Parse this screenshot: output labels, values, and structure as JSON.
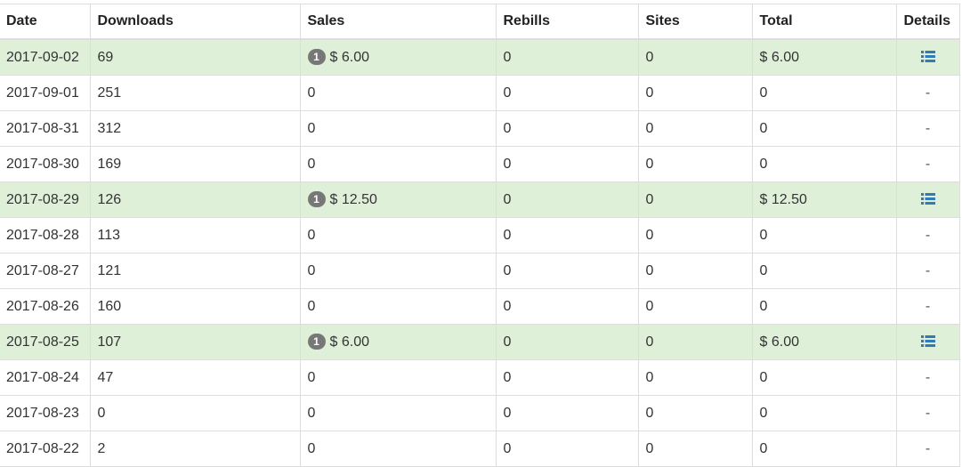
{
  "table": {
    "headers": {
      "date": "Date",
      "downloads": "Downloads",
      "sales": "Sales",
      "rebills": "Rebills",
      "sites": "Sites",
      "total": "Total",
      "details": "Details"
    },
    "rows": [
      {
        "date": "2017-09-02",
        "downloads": "69",
        "sales_count": "1",
        "sales": "$ 6.00",
        "rebills": "0",
        "sites": "0",
        "total": "$ 6.00",
        "details": "",
        "highlight": true
      },
      {
        "date": "2017-09-01",
        "downloads": "251",
        "sales_count": "",
        "sales": "0",
        "rebills": "0",
        "sites": "0",
        "total": "0",
        "details": "-",
        "highlight": false
      },
      {
        "date": "2017-08-31",
        "downloads": "312",
        "sales_count": "",
        "sales": "0",
        "rebills": "0",
        "sites": "0",
        "total": "0",
        "details": "-",
        "highlight": false
      },
      {
        "date": "2017-08-30",
        "downloads": "169",
        "sales_count": "",
        "sales": "0",
        "rebills": "0",
        "sites": "0",
        "total": "0",
        "details": "-",
        "highlight": false
      },
      {
        "date": "2017-08-29",
        "downloads": "126",
        "sales_count": "1",
        "sales": "$ 12.50",
        "rebills": "0",
        "sites": "0",
        "total": "$ 12.50",
        "details": "",
        "highlight": true
      },
      {
        "date": "2017-08-28",
        "downloads": "113",
        "sales_count": "",
        "sales": "0",
        "rebills": "0",
        "sites": "0",
        "total": "0",
        "details": "-",
        "highlight": false
      },
      {
        "date": "2017-08-27",
        "downloads": "121",
        "sales_count": "",
        "sales": "0",
        "rebills": "0",
        "sites": "0",
        "total": "0",
        "details": "-",
        "highlight": false
      },
      {
        "date": "2017-08-26",
        "downloads": "160",
        "sales_count": "",
        "sales": "0",
        "rebills": "0",
        "sites": "0",
        "total": "0",
        "details": "-",
        "highlight": false
      },
      {
        "date": "2017-08-25",
        "downloads": "107",
        "sales_count": "1",
        "sales": "$ 6.00",
        "rebills": "0",
        "sites": "0",
        "total": "$ 6.00",
        "details": "",
        "highlight": true
      },
      {
        "date": "2017-08-24",
        "downloads": "47",
        "sales_count": "",
        "sales": "0",
        "rebills": "0",
        "sites": "0",
        "total": "0",
        "details": "-",
        "highlight": false
      },
      {
        "date": "2017-08-23",
        "downloads": "0",
        "sales_count": "",
        "sales": "0",
        "rebills": "0",
        "sites": "0",
        "total": "0",
        "details": "-",
        "highlight": false
      },
      {
        "date": "2017-08-22",
        "downloads": "2",
        "sales_count": "",
        "sales": "0",
        "rebills": "0",
        "sites": "0",
        "total": "0",
        "details": "-",
        "highlight": false
      }
    ]
  },
  "icons": {
    "details_icon": "list-icon"
  },
  "colors": {
    "highlight_row": "#dff0d8",
    "badge": "#777777",
    "icon": "#337ab7",
    "border": "#dddddd"
  }
}
